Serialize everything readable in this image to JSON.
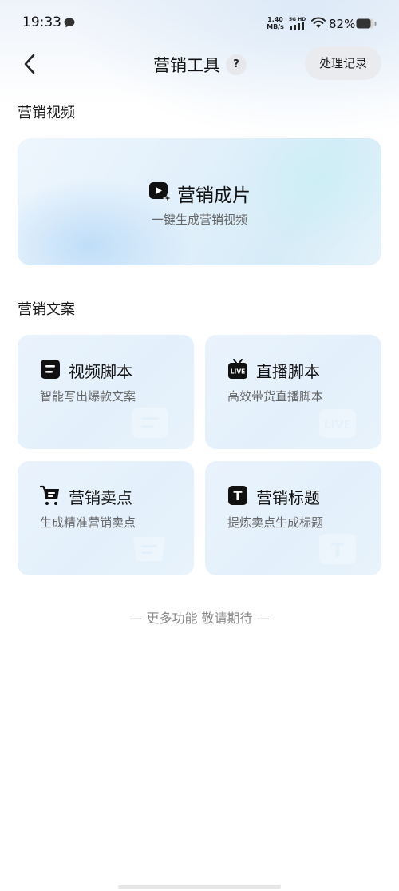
{
  "status_bar": {
    "time": "19:33",
    "net_speed_value": "1.40",
    "net_speed_unit": "MB/s",
    "network_label": "5G HD",
    "battery": "82%"
  },
  "nav": {
    "title": "营销工具",
    "help": "?",
    "history_button": "处理记录"
  },
  "sections": {
    "video": "营销视频",
    "copy": "营销文案"
  },
  "hero": {
    "title": "营销成片",
    "subtitle": "一键生成营销视频",
    "icon": "video-sparkle-icon"
  },
  "tools": [
    {
      "title": "视频脚本",
      "desc": "智能写出爆款文案",
      "icon": "script-icon"
    },
    {
      "title": "直播脚本",
      "desc": "高效带货直播脚本",
      "icon": "live-tv-icon",
      "icon_text": "LIVE"
    },
    {
      "title": "营销卖点",
      "desc": "生成精准营销卖点",
      "icon": "cart-icon"
    },
    {
      "title": "营销标题",
      "desc": "提炼卖点生成标题",
      "icon": "text-t-icon",
      "icon_text": "T"
    }
  ],
  "footer": {
    "more": "— 更多功能 敬请期待 —"
  },
  "colors": {
    "card_bg": "#e3f0fb",
    "text_primary": "#111111",
    "text_secondary": "#666666",
    "hint": "#888888"
  }
}
